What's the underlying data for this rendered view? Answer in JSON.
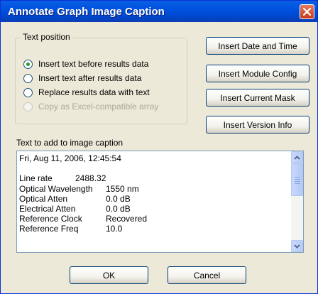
{
  "window": {
    "title": "Annotate Graph Image Caption"
  },
  "text_position": {
    "legend": "Text position",
    "options": [
      {
        "label": "Insert text before results data",
        "checked": true,
        "enabled": true
      },
      {
        "label": "Insert text after results data",
        "checked": false,
        "enabled": true
      },
      {
        "label": "Replace results data with text",
        "checked": false,
        "enabled": true
      },
      {
        "label": "Copy as Excel-compatible array",
        "checked": false,
        "enabled": false
      }
    ]
  },
  "insert_buttons": {
    "date_time": "Insert Date and Time",
    "module_config": "Insert Module Config",
    "current_mask": "Insert Current Mask",
    "version_info": "Insert Version Info"
  },
  "caption": {
    "label": "Text to add to image caption",
    "lines": [
      {
        "name": "Fri, Aug 11, 2006, 12:45:54",
        "value": ""
      },
      {
        "name": "",
        "value": ""
      },
      {
        "name": "Line rate",
        "value": "2488.32"
      },
      {
        "name": "Optical Wavelength",
        "value": "1550 nm"
      },
      {
        "name": "Optical Atten",
        "value": "0.0 dB"
      },
      {
        "name": "Electrical Atten",
        "value": "0.0 dB"
      },
      {
        "name": "Reference Clock",
        "value": "Recovered"
      },
      {
        "name": "Reference Freq",
        "value": "10.0"
      }
    ]
  },
  "footer": {
    "ok": "OK",
    "cancel": "Cancel"
  }
}
